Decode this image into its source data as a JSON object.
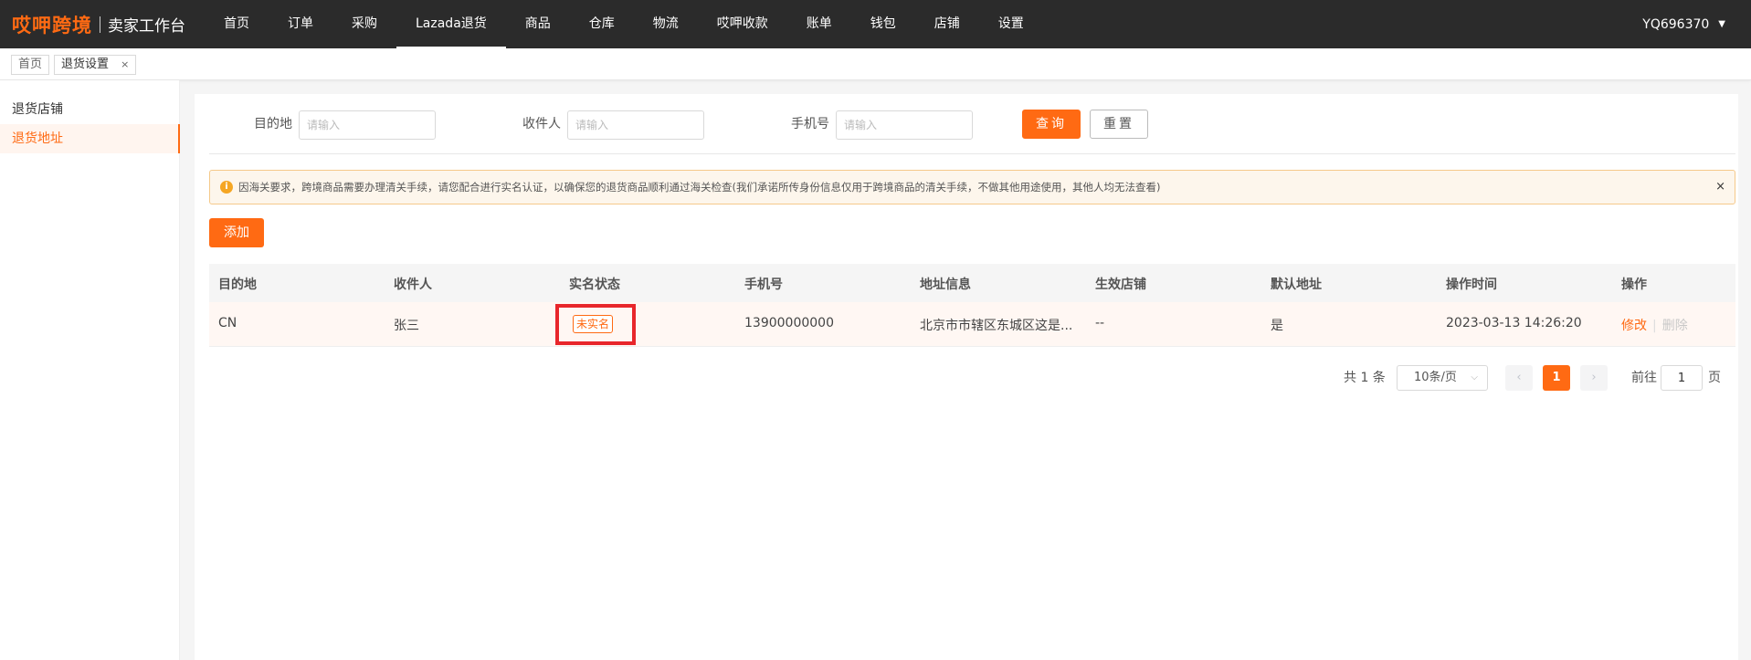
{
  "header": {
    "brand": "哎呷跨境",
    "subtitle": "卖家工作台",
    "nav": [
      {
        "label": "首页"
      },
      {
        "label": "订单"
      },
      {
        "label": "采购"
      },
      {
        "label": "Lazada退货",
        "active": true
      },
      {
        "label": "商品"
      },
      {
        "label": "仓库"
      },
      {
        "label": "物流"
      },
      {
        "label": "哎呷收款"
      },
      {
        "label": "账单"
      },
      {
        "label": "钱包"
      },
      {
        "label": "店铺"
      },
      {
        "label": "设置"
      }
    ],
    "user": "YQ696370",
    "user_caret": "▼"
  },
  "tabs": [
    {
      "label": "首页"
    },
    {
      "label": "退货设置",
      "close": "×"
    }
  ],
  "sidebar": {
    "items": [
      {
        "label": "退货店铺"
      },
      {
        "label": "退货地址",
        "active": true
      }
    ]
  },
  "filters": {
    "destination": {
      "label": "目的地",
      "placeholder": "请输入"
    },
    "recipient": {
      "label": "收件人",
      "placeholder": "请输入"
    },
    "phone": {
      "label": "手机号",
      "placeholder": "请输入"
    },
    "query_label": "查询",
    "reset_label": "重置"
  },
  "alert": {
    "icon": "i",
    "text": "因海关要求，跨境商品需要办理清关手续，请您配合进行实名认证，以确保您的退货商品顺利通过海关检查(我们承诺所传身份信息仅用于跨境商品的清关手续，不做其他用途使用，其他人均无法查看)",
    "close": "×"
  },
  "add_label": "添加",
  "table": {
    "columns": [
      "目的地",
      "收件人",
      "实名状态",
      "手机号",
      "地址信息",
      "生效店铺",
      "默认地址",
      "操作时间",
      "操作"
    ],
    "rows": [
      {
        "destination": "CN",
        "recipient": "张三",
        "status": "未实名",
        "phone": "13900000000",
        "address": "北京市市辖区东城区这是...",
        "store": "--",
        "default": "是",
        "time": "2023-03-13 14:26:20",
        "edit": "修改",
        "delete": "删除"
      }
    ]
  },
  "pagination": {
    "total": "共 1 条",
    "page_size": "10条/页",
    "prev": "‹",
    "next": "›",
    "current": "1",
    "goto_label": "前往",
    "goto_value": "1",
    "goto_suffix": "页"
  },
  "colors": {
    "accent": "#ff6a13",
    "topbar": "#2b2b2b",
    "highlight": "#e8262b"
  }
}
